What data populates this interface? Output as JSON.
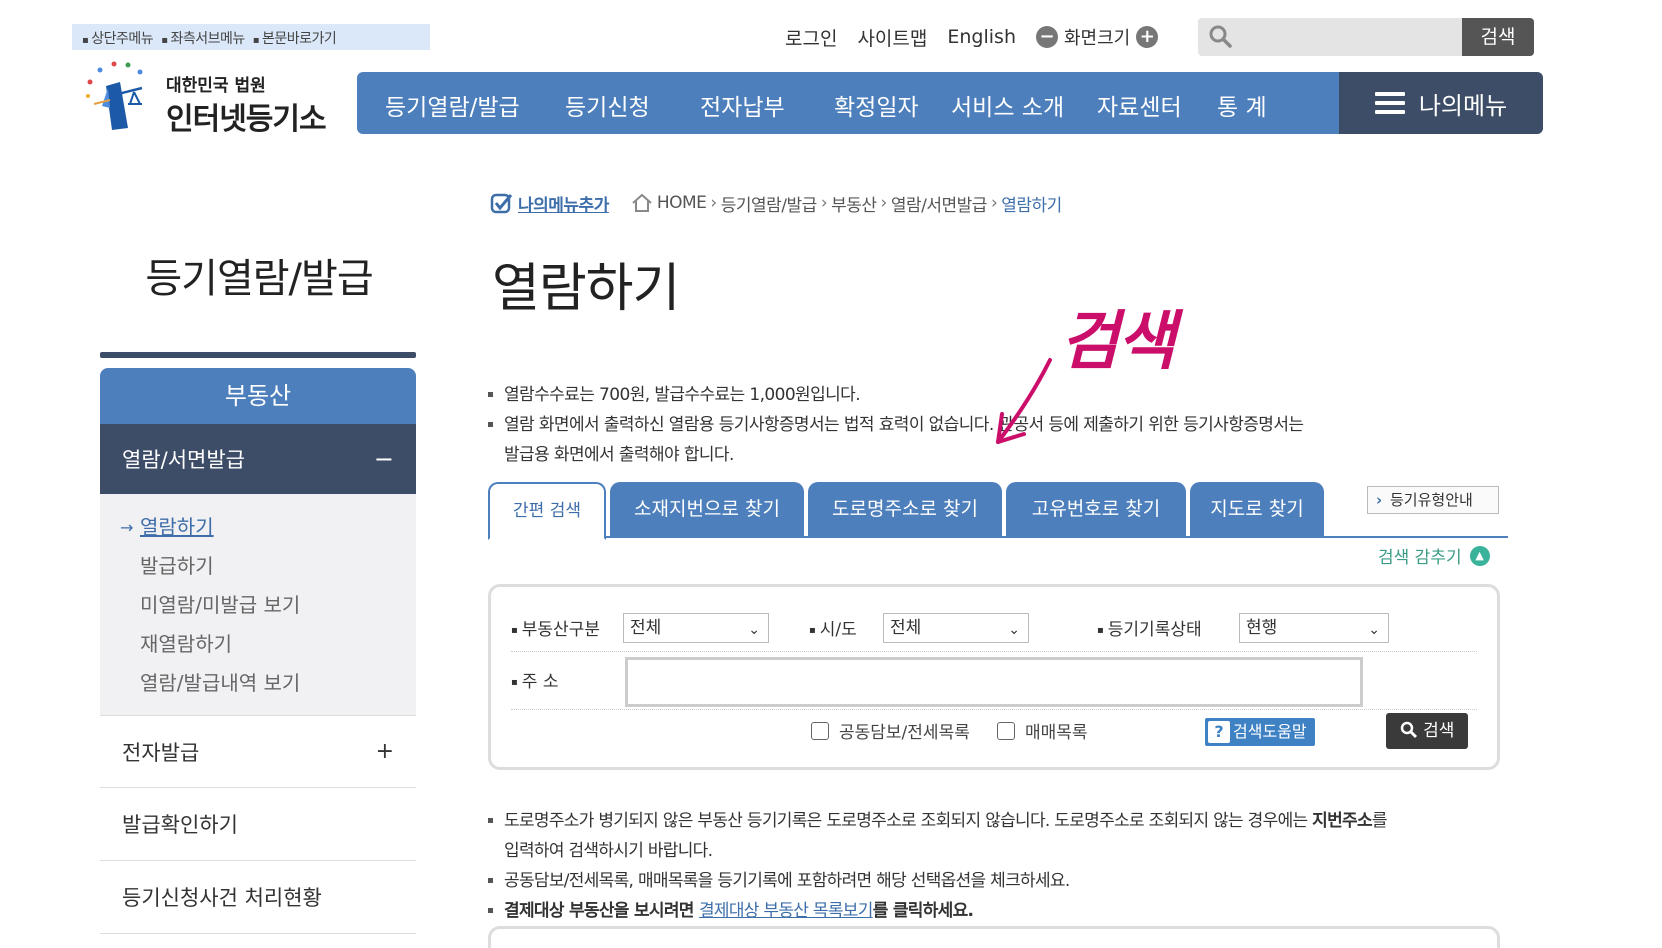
{
  "skip_links": [
    "상단주메뉴",
    "좌측서브메뉴",
    "본문바로가기"
  ],
  "top": {
    "login": "로그인",
    "sitemap": "사이트맵",
    "english": "English",
    "zoom": "화면크기",
    "zoom_out": "−",
    "zoom_in": "+",
    "search_placeholder": "",
    "search_button": "검색"
  },
  "logo": {
    "line1": "대한민국 법원",
    "line2": "인터넷등기소"
  },
  "gnb": {
    "items": [
      "등기열람/발급",
      "등기신청",
      "전자납부",
      "확정일자",
      "서비스 소개",
      "자료센터",
      "통 계"
    ],
    "mymenu": "나의메뉴"
  },
  "breadcrumb": {
    "add": "나의메뉴추가",
    "home": "HOME",
    "items": [
      "등기열람/발급",
      "부동산",
      "열람/서면발급"
    ],
    "current": "열람하기"
  },
  "side": {
    "title": "등기열람/발급",
    "head": "부동산",
    "sub_active": "열람/서면발급",
    "sub_toggle": "−",
    "subnav": [
      "열람하기",
      "발급하기",
      "미열람/미발급 보기",
      "재열람하기",
      "열람/발급내역 보기"
    ],
    "sections": [
      {
        "label": "전자발급",
        "toggle": "+"
      },
      {
        "label": "발급확인하기",
        "toggle": ""
      },
      {
        "label": "등기신청사건 처리현황",
        "toggle": ""
      }
    ]
  },
  "page_title": "열람하기",
  "notes1": [
    "열람수수료는 700원, 발급수수료는 1,000원입니다.",
    "열람 화면에서 출력하신 열람용 등기사항증명서는 법적 효력이 없습니다. 관공서 등에 제출하기 위한 등기사항증명서는",
    "발급용 화면에서 출력해야 합니다."
  ],
  "tabs": [
    "간편 검색",
    "소재지번으로 찾기",
    "도로명주소로 찾기",
    "고유번호로 찾기",
    "지도로 찾기"
  ],
  "type_guide": "등기유형안내",
  "collapse": "검색 감추기",
  "form": {
    "realty_label": "부동산구분",
    "realty_value": "전체",
    "sido_label": "시/도",
    "sido_value": "전체",
    "status_label": "등기기록상태",
    "status_value": "현행",
    "address_label": "주 소",
    "address_value": "",
    "chk1": "공동담보/전세목록",
    "chk2": "매매목록",
    "help": "검색도움말",
    "search": "검색",
    "chev": "⌄"
  },
  "notes2": {
    "line1_a": "도로명주소가 병기되지 않은 부동산 등기기록은 도로명주소로 조회되지 않습니다. 도로명주소로 조회되지 않는 경우에는 ",
    "line1_b": "지번주소",
    "line1_c": "를",
    "line2": "입력하여 검색하시기 바랍니다.",
    "line3": "공동담보/전세목록, 매매목록을 등기기록에 포함하려면 해당 선택옵션을 체크하세요.",
    "line4_a": "결제대상 부동산을 보시려면 ",
    "line4_link": "결제대상 부동산 목록보기",
    "line4_c": "를 클릭하세요."
  },
  "annotation": "검색",
  "colors": {
    "primary": "#4d7fbc",
    "dark": "#3d4d67",
    "annotation": "#cc0e6b",
    "collapse": "#3bb29a"
  }
}
